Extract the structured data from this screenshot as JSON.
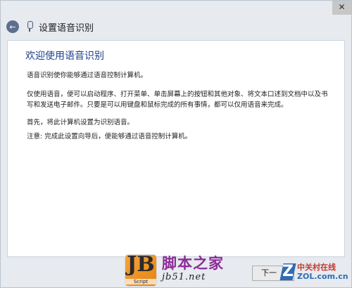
{
  "window": {
    "title": "设置语音识别",
    "close_glyph": "✕",
    "back_glyph": "←"
  },
  "content": {
    "heading": "欢迎使用语音识别",
    "paragraphs": [
      "语音识别使你能够通过语音控制计算机。",
      "仅使用语音，便可以启动程序、打开菜单、单击屏幕上的按钮和其他对象、将文本口述到文档中以及书写和发送电子邮件。只要是可以用键盘和鼠标完成的所有事情，都可以仅用语音来完成。",
      "首先，将此计算机设置为识别语音。",
      "注意: 完成此设置向导后，便能够通过语音控制计算机。"
    ]
  },
  "footer": {
    "next_label": "下一"
  },
  "watermark": {
    "logo_letters": "JB",
    "logo_caption": "Script",
    "site_name": "脚本之家",
    "site_url": "jb51.net"
  },
  "zol": {
    "mark": "Z",
    "name_cn": "中关村在线",
    "name_en": "ZOL.com.cn"
  },
  "colors": {
    "heading": "#1b3f8c",
    "window_bg": "#e7eaef",
    "content_bg": "#ffffff"
  }
}
